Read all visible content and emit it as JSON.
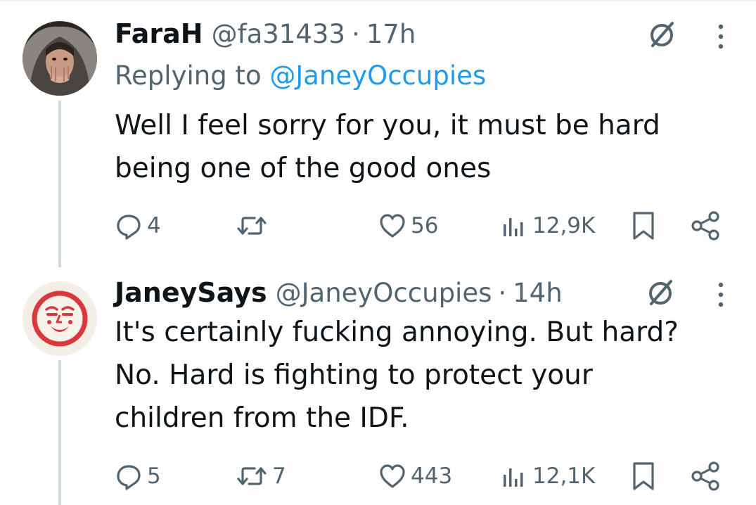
{
  "tweets": [
    {
      "display_name": "FaraH",
      "handle": "@fa31433",
      "separator": "·",
      "time": "17h",
      "replying_prefix": "Replying to",
      "replying_to": "@JaneyOccupies",
      "text_lines": [
        "Well I feel sorry for you, it must be hard",
        "being one of the good ones"
      ],
      "replies": "4",
      "retweets": "",
      "likes": "56",
      "views": "12,9K"
    },
    {
      "display_name": "JaneySays",
      "handle": "@JaneyOccupies",
      "separator": "·",
      "time": "14h",
      "text_lines": [
        "It's certainly fucking annoying. But hard?",
        "No. Hard is fighting to protect your",
        "children from the IDF."
      ],
      "replies": "5",
      "retweets": "7",
      "likes": "443",
      "views": "12,1K"
    }
  ],
  "colors": {
    "text": "#0f1419",
    "secondary": "#536471",
    "mention": "#1d9bf0",
    "thread_line": "#cfd9de",
    "avatar2_red": "#d9383c"
  },
  "icons": [
    "grok-icon",
    "more-icon",
    "reply-icon",
    "retweet-icon",
    "like-icon",
    "views-icon",
    "bookmark-icon",
    "share-icon"
  ]
}
